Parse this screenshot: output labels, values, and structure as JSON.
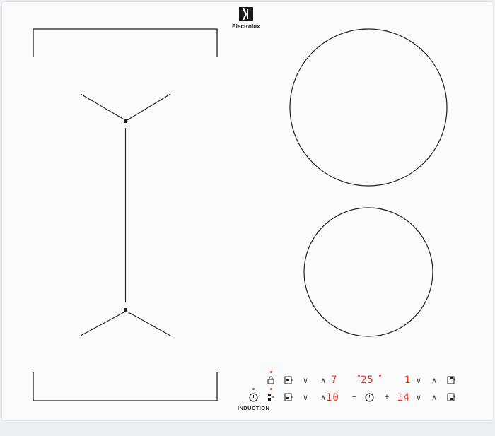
{
  "brand": {
    "name": "Electrolux"
  },
  "label_induction": "INDUCTION",
  "zone_left": {
    "timer_display": "7",
    "power_display": "10",
    "minus_symbol": "∨",
    "plus_symbol": "∧"
  },
  "center": {
    "timer_display": "25",
    "minus_symbol": "−",
    "plus_symbol": "+",
    "value_display": "14"
  },
  "zone_right": {
    "power_top_display": "1",
    "minus_symbol": "∨",
    "plus_symbol": "∧"
  },
  "colors": {
    "surface": "#fbfbfc",
    "lines": "#1f1f1f",
    "display_red": "#e8321e"
  }
}
